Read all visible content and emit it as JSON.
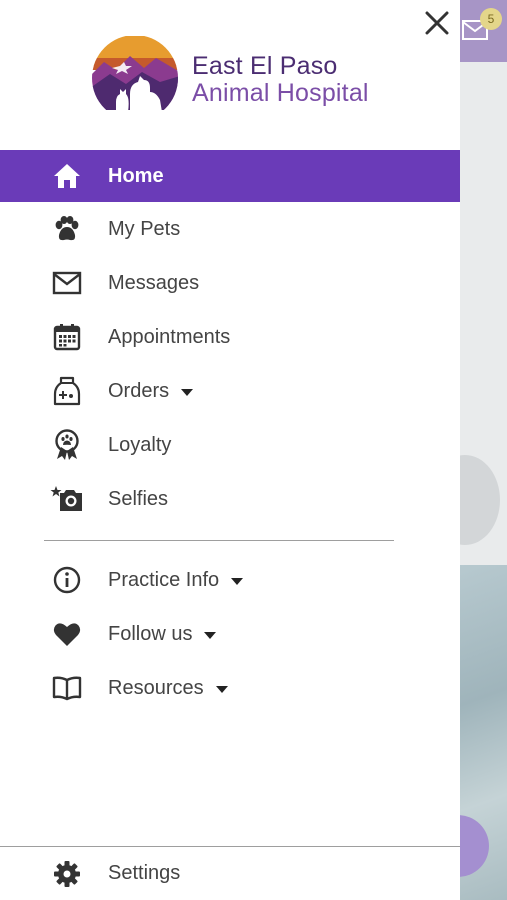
{
  "logo": {
    "line1": "East El Paso",
    "line2": "Animal Hospital"
  },
  "menu": [
    {
      "label": "Home",
      "icon": "home-icon",
      "active": true
    },
    {
      "label": "My Pets",
      "icon": "paw-icon"
    },
    {
      "label": "Messages",
      "icon": "envelope-icon"
    },
    {
      "label": "Appointments",
      "icon": "calendar-icon"
    },
    {
      "label": "Orders",
      "icon": "pet-food-bag-icon",
      "expandable": true
    },
    {
      "label": "Loyalty",
      "icon": "award-ribbon-icon"
    },
    {
      "label": "Selfies",
      "icon": "camera-star-icon"
    }
  ],
  "menu2": [
    {
      "label": "Practice Info",
      "icon": "info-icon",
      "expandable": true
    },
    {
      "label": "Follow us",
      "icon": "heart-icon",
      "expandable": true
    },
    {
      "label": "Resources",
      "icon": "book-icon",
      "expandable": true
    }
  ],
  "footer": {
    "settings_label": "Settings",
    "icon": "gear-icon"
  },
  "background": {
    "message_badge": "5"
  },
  "colors": {
    "accent": "#6a3bb8",
    "brand_dark": "#4b2d72",
    "brand_light": "#7b4ea7"
  }
}
